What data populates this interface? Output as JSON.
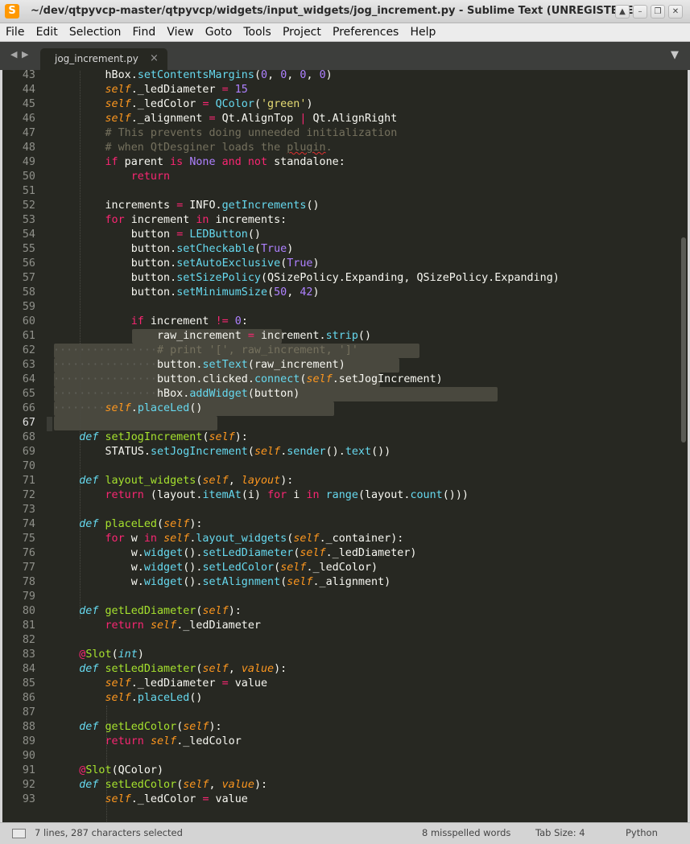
{
  "window": {
    "title": "~/dev/qtpyvcp-master/qtpyvcp/widgets/input_widgets/jog_increment.py - Sublime Text (UNREGISTERED)",
    "logo_letter": "S"
  },
  "menu": [
    "File",
    "Edit",
    "Selection",
    "Find",
    "View",
    "Goto",
    "Tools",
    "Project",
    "Preferences",
    "Help"
  ],
  "tabs": [
    {
      "label": "jog_increment.py",
      "close": "×"
    }
  ],
  "editor": {
    "first_line": 43,
    "current_line": 67,
    "lines": [
      "        hBox.setContentsMargins(0, 0, 0, 0)",
      "        self._ledDiameter = 15",
      "        self._ledColor = QColor('green')",
      "        self._alignment = Qt.AlignTop | Qt.AlignRight",
      "        # This prevents doing unneeded initialization",
      "        # when QtDesginer loads the plugin.",
      "        if parent is None and not standalone:",
      "            return",
      "",
      "        increments = INFO.getIncrements()",
      "        for increment in increments:",
      "            button = LEDButton()",
      "            button.setCheckable(True)",
      "            button.setAutoExclusive(True)",
      "            button.setSizePolicy(QSizePolicy.Expanding, QSizePolicy.Expanding)",
      "            button.setMinimumSize(50, 42)",
      "",
      "            if increment != 0:",
      "                raw_increment = increment.strip()",
      "                # print '[', raw_increment, ']'",
      "                button.setText(raw_increment)",
      "                button.clicked.connect(self.setJogIncrement)",
      "                hBox.addWidget(button)",
      "        self.placeLed()",
      "",
      "    def setJogIncrement(self):",
      "        STATUS.setJogIncrement(self.sender().text())",
      "",
      "    def layout_widgets(self, layout):",
      "        return (layout.itemAt(i) for i in range(layout.count()))",
      "",
      "    def placeLed(self):",
      "        for w in self.layout_widgets(self._container):",
      "            w.widget().setLedDiameter(self._ledDiameter)",
      "            w.widget().setLedColor(self._ledColor)",
      "            w.widget().setAlignment(self._alignment)",
      "",
      "    def getLedDiameter(self):",
      "        return self._ledDiameter",
      "",
      "    @Slot(int)",
      "    def setLedDiameter(self, value):",
      "        self._ledDiameter = value",
      "        self.placeLed()",
      "",
      "    def getLedColor(self):",
      "        return self._ledColor",
      "",
      "    @Slot(QColor)",
      "    def setLedColor(self, value):",
      "        self._ledColor = value"
    ]
  },
  "status": {
    "selection": "7 lines, 287 characters selected",
    "spelling": "8 misspelled words",
    "tab_size": "Tab Size: 4",
    "syntax": "Python"
  },
  "icons": {
    "nav_left": "◀",
    "nav_right": "▶",
    "dropdown": "▼",
    "win_up": "▲",
    "win_min": "–",
    "win_restore": "❐",
    "win_close": "✕"
  },
  "theme": {
    "editor_bg": "#272822",
    "selection": "#49483e",
    "keyword": "#f92672",
    "function": "#a6e22e",
    "builtin": "#66d9ef",
    "number": "#ae81ff",
    "string": "#e6db74",
    "comment": "#75715e",
    "self": "#fd971f"
  }
}
